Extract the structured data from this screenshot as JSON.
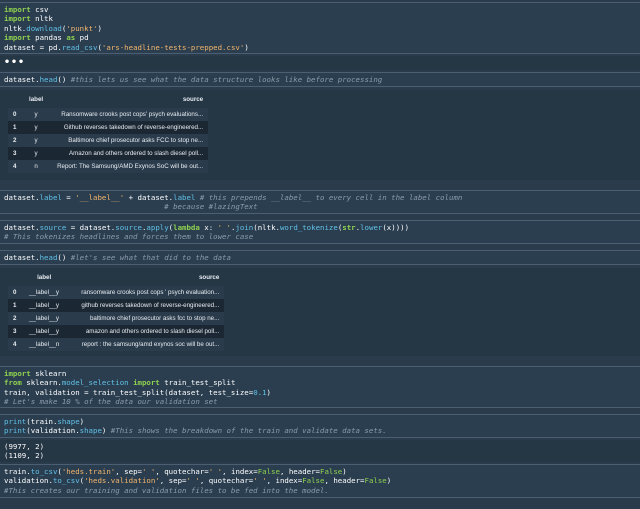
{
  "cells": {
    "c1": {
      "l1": [
        "import",
        " csv"
      ],
      "l2": [
        "import",
        " nltk"
      ],
      "l3": [
        "nltk.",
        "download",
        "(",
        "'punkt'",
        ")"
      ],
      "l4": [
        "import",
        " pandas ",
        "as",
        " pd"
      ],
      "l5": [
        "dataset = pd.",
        "read_csv",
        "(",
        "'ars-headline-tests-prepped.csv'",
        ")"
      ]
    },
    "collapsed": "•••",
    "c2": {
      "code": "dataset.",
      "fn": "head",
      "paren": "()",
      "comment": " #this lets us see what the data structure looks like before processing"
    },
    "table1": {
      "columns": [
        "label",
        "source"
      ],
      "rows": [
        {
          "index": "0",
          "label": "y",
          "source": "Ransomware crooks post cops' psych evaluations..."
        },
        {
          "index": "1",
          "label": "y",
          "source": "Github reverses takedown of reverse-engineered..."
        },
        {
          "index": "2",
          "label": "y",
          "source": "Baltimore chief prosecutor asks FCC to stop ne..."
        },
        {
          "index": "3",
          "label": "y",
          "source": "Amazon and others ordered to slash diesel poll..."
        },
        {
          "index": "4",
          "label": "n",
          "source": "Report: The Samsung/AMD Exynos SoC will be out..."
        }
      ]
    },
    "c3": {
      "a": "dataset.",
      "b": "label",
      "c": " = ",
      "d": "'__label__'",
      "e": " + dataset.",
      "f": "label",
      "comment1": " # this prepends __label__ to every cell in the label column",
      "comment2": "                                    # because #lazingText"
    },
    "c4": {
      "a": "dataset.",
      "b": "source",
      "c": " = dataset.",
      "d": "source",
      "e": ".",
      "f": "apply",
      "g": "(",
      "h": "lambda",
      "i": " x: ",
      "j": "' '",
      "k": ".",
      "l": "join",
      "m": "(nltk.",
      "n": "word_tokenize",
      "o": "(",
      "p": "str",
      "q": ".",
      "r": "lower",
      "s": "(x))))",
      "comment": "# This tokenizes headlines and forces them to lower case"
    },
    "c5": {
      "code": "dataset.",
      "fn": "head",
      "paren": "()",
      "comment": " #let's see what that did to the data"
    },
    "table2": {
      "columns": [
        "label",
        "source"
      ],
      "rows": [
        {
          "index": "0",
          "label": "__label__y",
          "source": "ransomware crooks post cops ' psych evaluation..."
        },
        {
          "index": "1",
          "label": "__label__y",
          "source": "github reverses takedown of reverse-engineered..."
        },
        {
          "index": "2",
          "label": "__label__y",
          "source": "baltimore chief prosecutor asks fcc to stop ne..."
        },
        {
          "index": "3",
          "label": "__label__y",
          "source": "amazon and others ordered to slash diesel poll..."
        },
        {
          "index": "4",
          "label": "__label__n",
          "source": "report : the samsung/amd exynos soc will be out..."
        }
      ]
    },
    "c6": {
      "l1": [
        "import",
        " sklearn"
      ],
      "l2": [
        "from",
        " sklearn.",
        "model_selection",
        " ",
        "import",
        " train_test_split"
      ],
      "l3": [
        "train, validation = train_test_split(dataset, test_size=",
        "0.1",
        ")"
      ],
      "l4": "# Let's make 10 % of the data our validation set"
    },
    "c7": {
      "l1": [
        "print",
        "(train.",
        "shape",
        ")"
      ],
      "l2": [
        "print",
        "(validation.",
        "shape",
        ")",
        " #This shows the breakdown of the train and validate data sets."
      ]
    },
    "out7": {
      "l1": "(9977, 2)",
      "l2": "(1109, 2)"
    },
    "c8": {
      "l1": [
        "train.",
        "to_csv",
        "(",
        "'heds.train'",
        ", sep=",
        "' '",
        ", quotechar=",
        "' '",
        ", index=",
        "False",
        ", header=",
        "False",
        ")"
      ],
      "l2": [
        "validation.",
        "to_csv",
        "(",
        "'heds.validation'",
        ", sep=",
        "' '",
        ", quotechar=",
        "' '",
        ", index=",
        "False",
        ", header=",
        "False",
        ")"
      ],
      "l3": "#This creates our training and validation files to be fed into the model."
    }
  },
  "colors": {
    "background": "#2a3b4b",
    "keyword": "#8fd14f",
    "string": "#f3b56b",
    "comment": "#8a9bab",
    "function": "#60c0e6"
  }
}
